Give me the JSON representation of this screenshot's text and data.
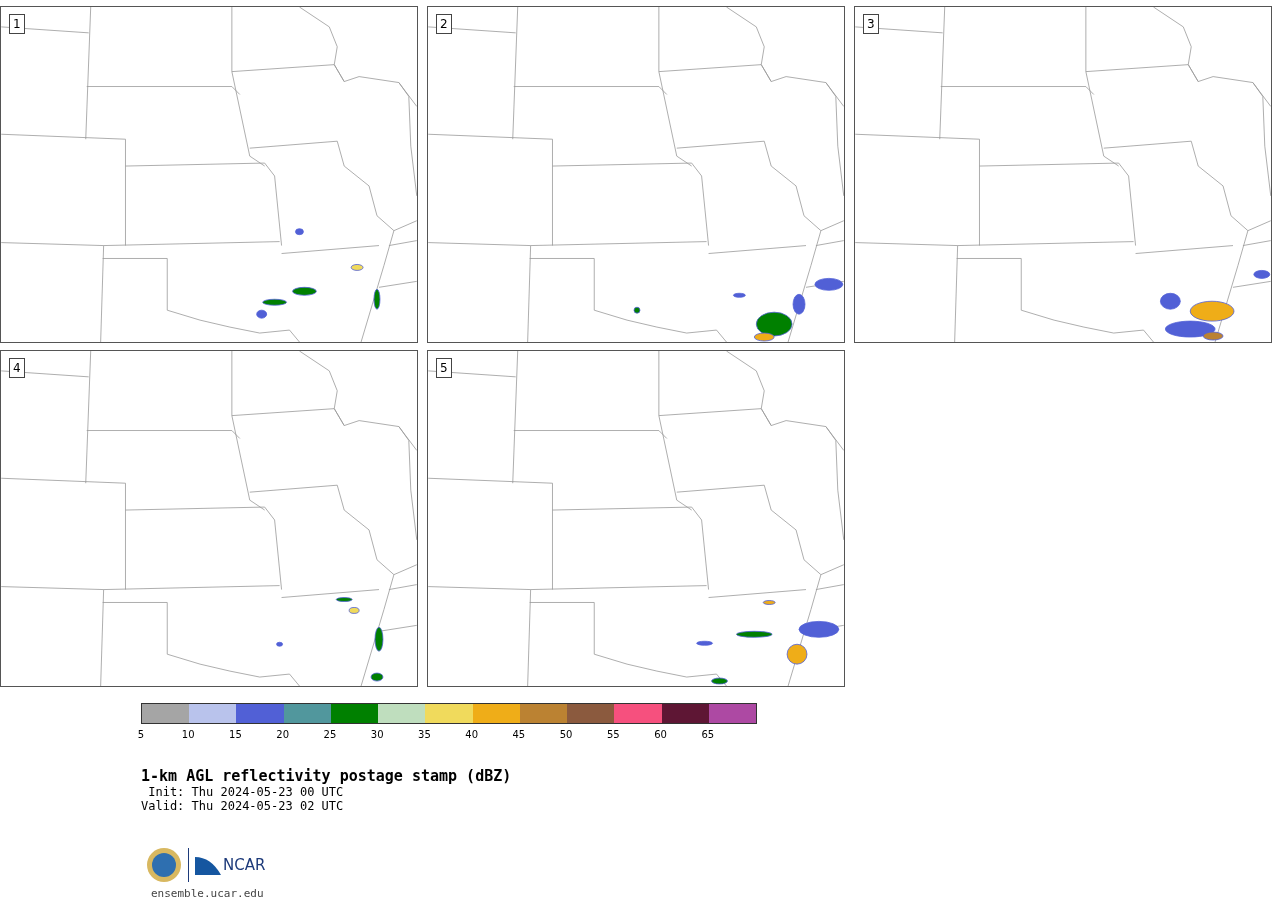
{
  "panels": [
    {
      "label": "1"
    },
    {
      "label": "2"
    },
    {
      "label": "3"
    },
    {
      "label": "4"
    },
    {
      "label": "5"
    }
  ],
  "colorbar": {
    "segments": [
      {
        "color": "#a5a5a5"
      },
      {
        "color": "#b9c3ec"
      },
      {
        "color": "#5160d6"
      },
      {
        "color": "#51979d"
      },
      {
        "color": "#008000"
      },
      {
        "color": "#bfdebe"
      },
      {
        "color": "#f0da5c"
      },
      {
        "color": "#efad18"
      },
      {
        "color": "#bb8232"
      },
      {
        "color": "#8b5a3e"
      },
      {
        "color": "#f6507e"
      },
      {
        "color": "#5e1634"
      },
      {
        "color": "#ad49a3"
      }
    ],
    "ticks": [
      "5",
      "10",
      "15",
      "20",
      "25",
      "30",
      "35",
      "40",
      "45",
      "50",
      "55",
      "60",
      "65"
    ]
  },
  "title": "1-km AGL reflectivity postage stamp (dBZ)",
  "init": " Init: Thu 2024-05-23 00 UTC",
  "valid": "Valid: Thu 2024-05-23 02 UTC",
  "logo_text": "NCAR",
  "url": "ensemble.ucar.edu"
}
